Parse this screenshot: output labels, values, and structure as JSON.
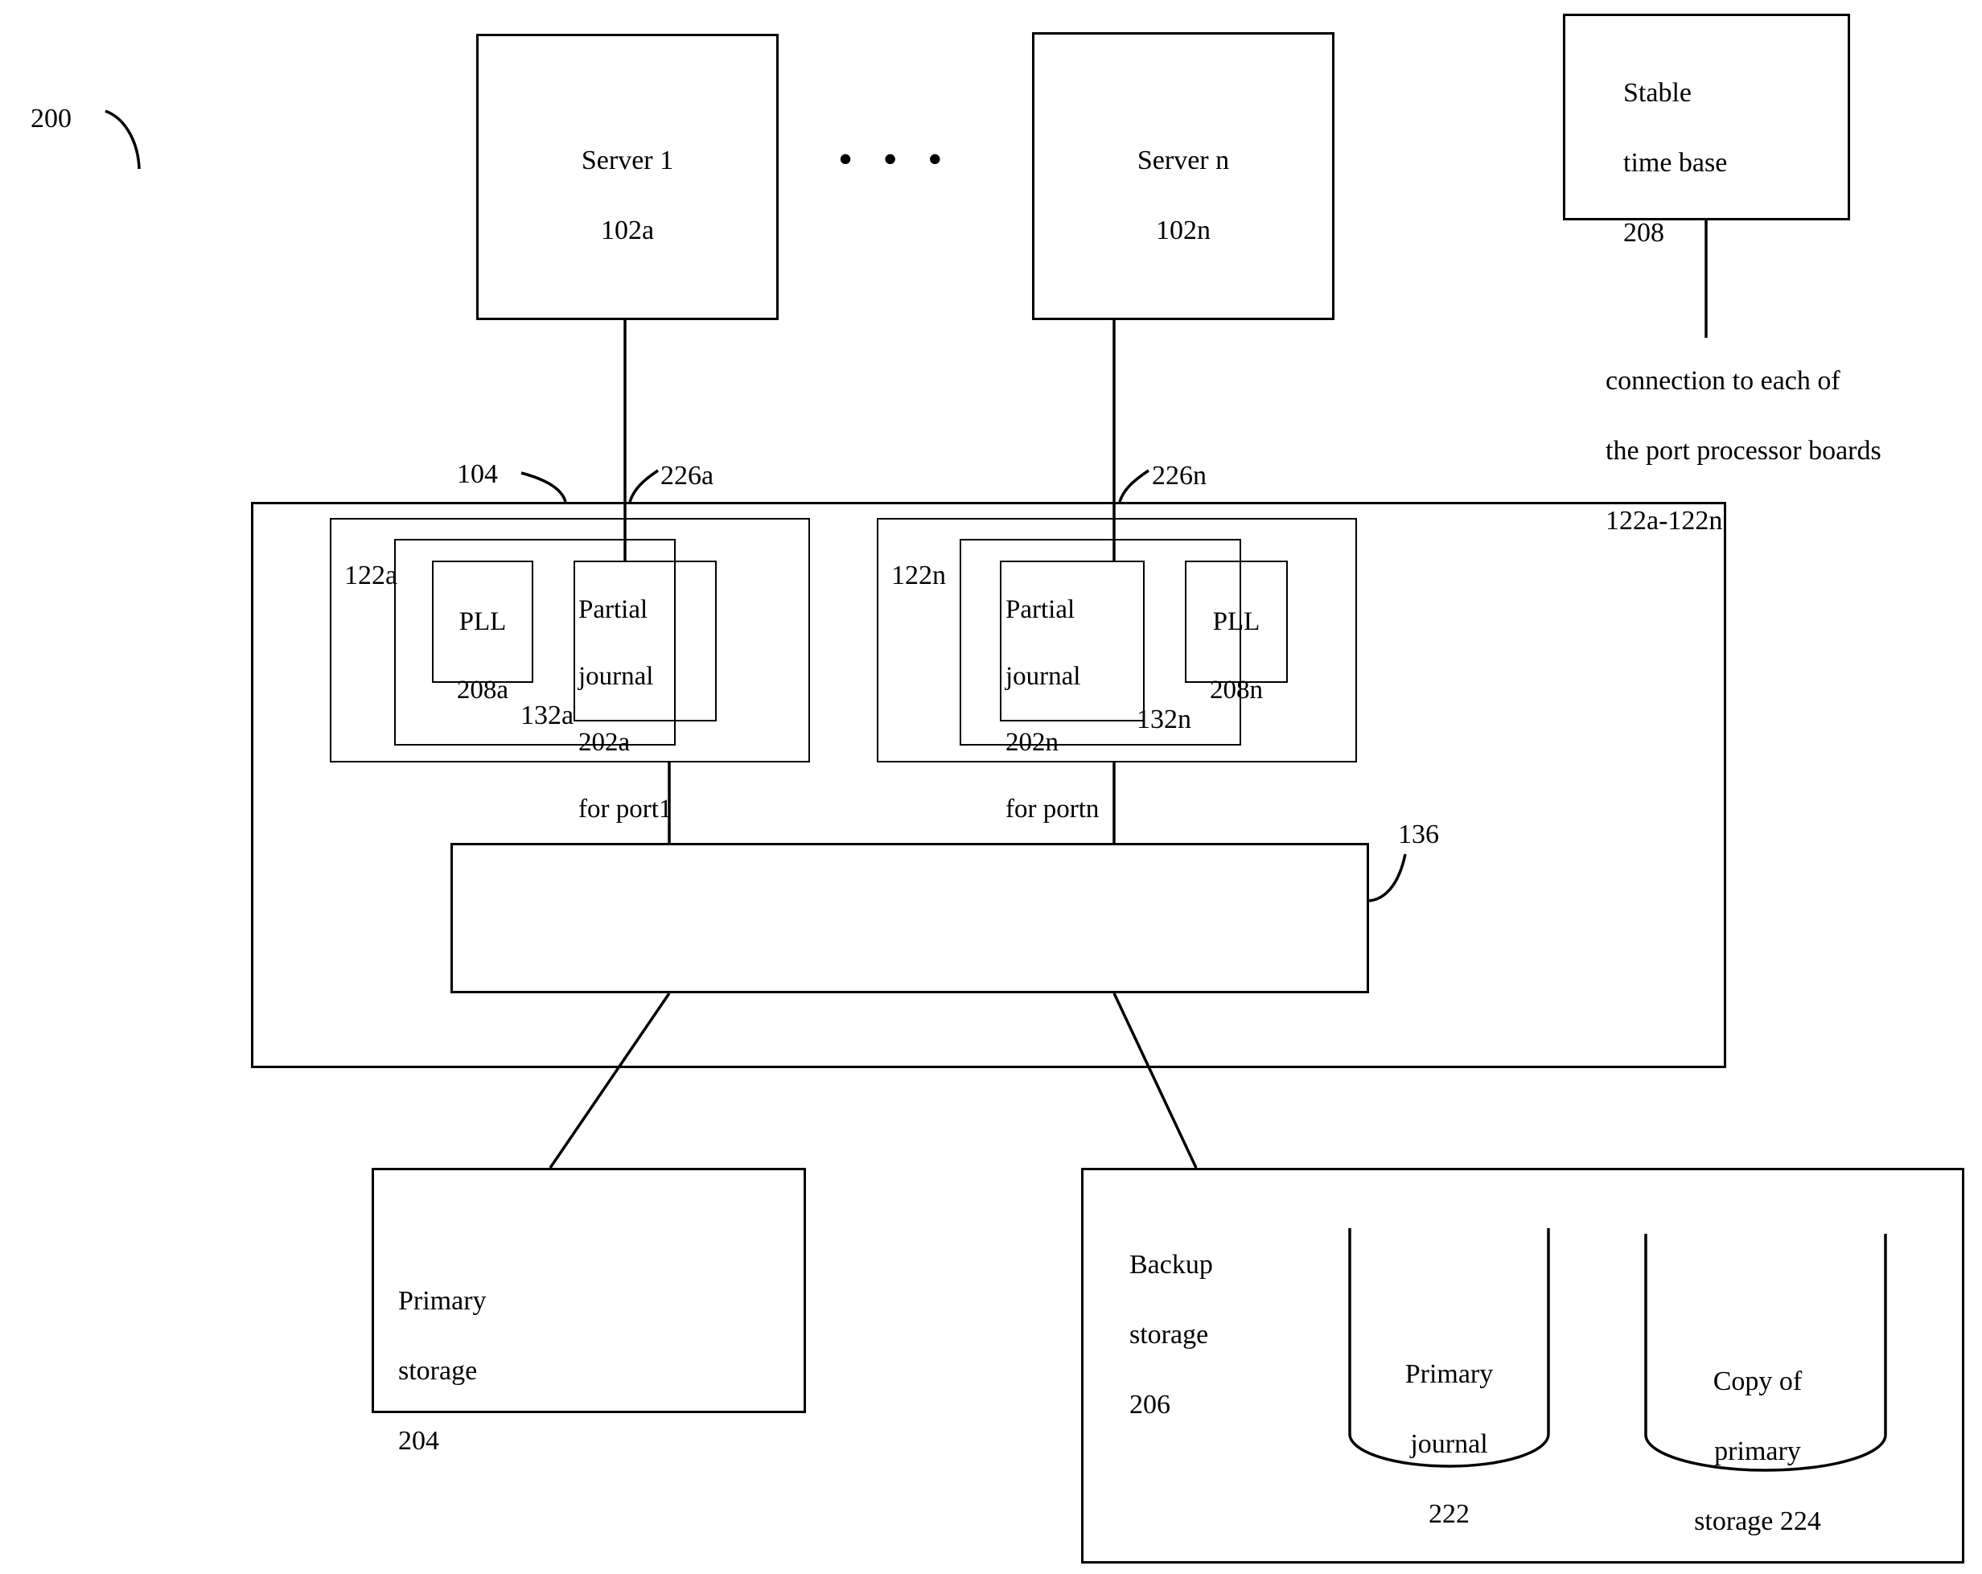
{
  "figure": {
    "number": "200"
  },
  "servers": [
    {
      "name": "Server 1",
      "ref": "102a"
    },
    {
      "name": "Server n",
      "ref": "102n"
    }
  ],
  "server_ellipsis": "• • •",
  "time_base": {
    "title_line1": "Stable",
    "title_line2": "time base",
    "ref": "208",
    "note_line1": "connection to each of",
    "note_line2": "the port processor boards",
    "note_line3": "122a-122n"
  },
  "switch": {
    "ref": "104",
    "bus_ref": "136",
    "link_refs": [
      "226a",
      "226n"
    ],
    "boards": [
      {
        "board_ref": "122a",
        "inner_ref": "132a",
        "pll": {
          "label": "PLL",
          "ref": "208a"
        },
        "journal": {
          "line1": "Partial",
          "line2": "journal",
          "line3": "202a",
          "line4": "for port1"
        }
      },
      {
        "board_ref": "122n",
        "inner_ref": "132n",
        "pll": {
          "label": "PLL",
          "ref": "208n"
        },
        "journal": {
          "line1": "Partial",
          "line2": "journal",
          "line3": "202n",
          "line4": "for portn"
        }
      }
    ]
  },
  "primary_storage": {
    "line1": "Primary",
    "line2": "storage",
    "ref": "204"
  },
  "backup_storage": {
    "line1": "Backup",
    "line2": "storage",
    "ref": "206",
    "cylinders": [
      {
        "line1": "Primary",
        "line2": "journal",
        "line3": "222"
      },
      {
        "line1": "Copy of",
        "line2": "primary",
        "line3": "storage 224"
      }
    ]
  }
}
